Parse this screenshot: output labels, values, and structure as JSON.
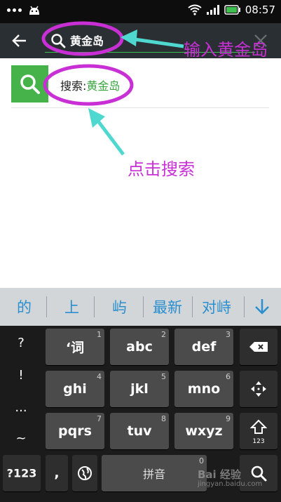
{
  "status_bar": {
    "time": "08:57"
  },
  "search": {
    "query": "黄金岛"
  },
  "result": {
    "prefix": "搜索:",
    "keyword": "黄金岛"
  },
  "annotations": {
    "input_note": "输入黄金岛",
    "click_note": "点击搜索",
    "color": "#c82fd4"
  },
  "candidates": [
    "的",
    "上",
    "屿",
    "最新",
    "对峙"
  ],
  "keyboard": {
    "side_keys": [
      "?",
      "!",
      "...",
      "~"
    ],
    "rows": [
      [
        {
          "label": "‘词",
          "num": "1"
        },
        {
          "label": "abc",
          "num": "2"
        },
        {
          "label": "def",
          "num": "3"
        }
      ],
      [
        {
          "label": "ghi",
          "num": "4"
        },
        {
          "label": "jkl",
          "num": "5"
        },
        {
          "label": "mno",
          "num": "6"
        }
      ],
      [
        {
          "label": "pqrs",
          "num": "7"
        },
        {
          "label": "tuv",
          "num": "8"
        },
        {
          "label": "wxyz",
          "num": "9"
        }
      ]
    ],
    "mode_key": "?123",
    "comma_key": ",",
    "space_label": "拼音",
    "space_num": "0",
    "shift_sub": "123"
  },
  "watermark": {
    "brand": "Bai 经验",
    "url": "jingyan.baidu.com"
  },
  "colors": {
    "accent_green": "#45b34a",
    "candidate_blue": "#2a8fce"
  }
}
